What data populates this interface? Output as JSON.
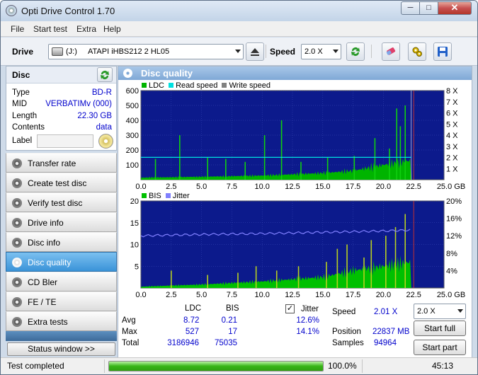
{
  "window": {
    "title": "Opti Drive Control 1.70",
    "min": "─",
    "max": "□",
    "close": "✕"
  },
  "menu": [
    "File",
    "Start test",
    "Extra",
    "Help"
  ],
  "toolbar": {
    "drive_label": "Drive",
    "drive_letter": "(J:)",
    "drive_value": "ATAPI iHBS212   2 HL05",
    "speed_label": "Speed",
    "speed_value": "2.0 X"
  },
  "disc": {
    "header": "Disc",
    "rows": [
      {
        "key": "Type",
        "value": "BD-R"
      },
      {
        "key": "MID",
        "value": "VERBATIMv (000)"
      },
      {
        "key": "Length",
        "value": "22.30 GB"
      },
      {
        "key": "Contents",
        "value": "data"
      }
    ],
    "label_key": "Label",
    "label_value": ""
  },
  "nav": [
    {
      "label": "Transfer rate",
      "active": false
    },
    {
      "label": "Create test disc",
      "active": false
    },
    {
      "label": "Verify test disc",
      "active": false
    },
    {
      "label": "Drive info",
      "active": false
    },
    {
      "label": "Disc info",
      "active": false
    },
    {
      "label": "Disc quality",
      "active": true
    },
    {
      "label": "CD Bler",
      "active": false
    },
    {
      "label": "FE / TE",
      "active": false
    },
    {
      "label": "Extra tests",
      "active": false
    }
  ],
  "status_window_button": "Status window >>",
  "panel": {
    "title": "Disc quality"
  },
  "colors": {
    "plot_bg": "#0c1a8c",
    "ldc": "#00b400",
    "read_speed": "#00e0e0",
    "write_speed": "#808080",
    "bis": "#00c000",
    "jitter": "#8080ff",
    "accent": "#3a93d8"
  },
  "chart_data": [
    {
      "type": "area",
      "legend": [
        "LDC",
        "Read speed",
        "Write speed"
      ],
      "x_ticks": [
        "0.0",
        "2.5",
        "5.0",
        "7.5",
        "10.0",
        "12.5",
        "15.0",
        "17.5",
        "20.0",
        "22.5",
        "25.0 GB"
      ],
      "y_ticks": [
        "600",
        "500",
        "400",
        "300",
        "200",
        "100"
      ],
      "y2_ticks": [
        "8 X",
        "7 X",
        "6 X",
        "5 X",
        "4 X",
        "3 X",
        "2 X",
        "1 X"
      ],
      "xlim": [
        0,
        25
      ],
      "ylim": [
        0,
        600
      ],
      "y2lim": [
        0,
        8
      ],
      "disc_end_gb": 22.3,
      "ldc_baseline": [
        [
          0,
          14
        ],
        [
          5,
          20
        ],
        [
          10,
          28
        ],
        [
          15,
          45
        ],
        [
          17.5,
          60
        ],
        [
          20,
          100
        ],
        [
          22.3,
          130
        ]
      ],
      "ldc_spikes": [
        [
          1.2,
          140
        ],
        [
          3.2,
          300
        ],
        [
          5.5,
          150
        ],
        [
          7.0,
          140
        ],
        [
          8.6,
          120
        ],
        [
          10.2,
          300
        ],
        [
          11.6,
          400
        ],
        [
          13.2,
          120
        ],
        [
          15.4,
          150
        ],
        [
          17.6,
          160
        ],
        [
          19.3,
          280
        ],
        [
          20.5,
          210
        ],
        [
          21.1,
          480
        ],
        [
          21.4,
          360
        ],
        [
          21.8,
          500
        ]
      ],
      "read_speed": [
        [
          0,
          2.01
        ],
        [
          22.3,
          2.01
        ]
      ],
      "read_speed_unit": "X",
      "write_speed_marker_gb": 22.5
    },
    {
      "type": "area",
      "legend": [
        "BIS",
        "Jitter"
      ],
      "x_ticks": [
        "0.0",
        "2.5",
        "5.0",
        "7.5",
        "10.0",
        "12.5",
        "15.0",
        "17.5",
        "20.0",
        "22.5",
        "25.0 GB"
      ],
      "y_ticks": [
        "20",
        "15",
        "10",
        "5"
      ],
      "y2_ticks": [
        "20%",
        "16%",
        "12%",
        "8%",
        "4%"
      ],
      "xlim": [
        0,
        25
      ],
      "ylim": [
        0,
        20
      ],
      "y2lim": [
        0,
        20
      ],
      "bis_baseline": [
        [
          0,
          0.3
        ],
        [
          5,
          0.8
        ],
        [
          10,
          1.5
        ],
        [
          15,
          2.5
        ],
        [
          17.5,
          4
        ],
        [
          20,
          5
        ],
        [
          22.3,
          6
        ]
      ],
      "bis_spikes": [
        [
          2.5,
          4
        ],
        [
          5.5,
          3
        ],
        [
          8.0,
          3.5
        ],
        [
          9.5,
          5
        ],
        [
          11.2,
          4
        ],
        [
          13.0,
          5
        ],
        [
          15.3,
          6
        ],
        [
          16.2,
          9
        ],
        [
          17.0,
          10
        ],
        [
          18.4,
          7
        ],
        [
          19.0,
          11
        ],
        [
          20.2,
          12
        ],
        [
          21.0,
          14
        ],
        [
          21.8,
          17
        ]
      ],
      "jitter": [
        [
          0,
          12.0
        ],
        [
          5,
          12.3
        ],
        [
          10,
          12.5
        ],
        [
          15,
          12.8
        ],
        [
          20,
          13.1
        ],
        [
          22.3,
          13.3
        ]
      ]
    }
  ],
  "stats": {
    "col_ldc": "LDC",
    "col_bis": "BIS",
    "col_jitter": "Jitter",
    "rows": [
      {
        "name": "Avg",
        "ldc": "8.72",
        "bis": "0.21",
        "jitter": "12.6%"
      },
      {
        "name": "Max",
        "ldc": "527",
        "bis": "17",
        "jitter": "14.1%"
      },
      {
        "name": "Total",
        "ldc": "3186946",
        "bis": "75035",
        "jitter": ""
      }
    ],
    "jitter_checked": true,
    "speed_label": "Speed",
    "speed_value": "2.01 X",
    "position_label": "Position",
    "position_value": "22837 MB",
    "samples_label": "Samples",
    "samples_value": "94964",
    "speed_select": "2.0 X",
    "start_full": "Start full",
    "start_part": "Start part"
  },
  "status": {
    "text": "Test completed",
    "progress": 100.0,
    "progress_label": "100.0%",
    "time": "45:13"
  }
}
